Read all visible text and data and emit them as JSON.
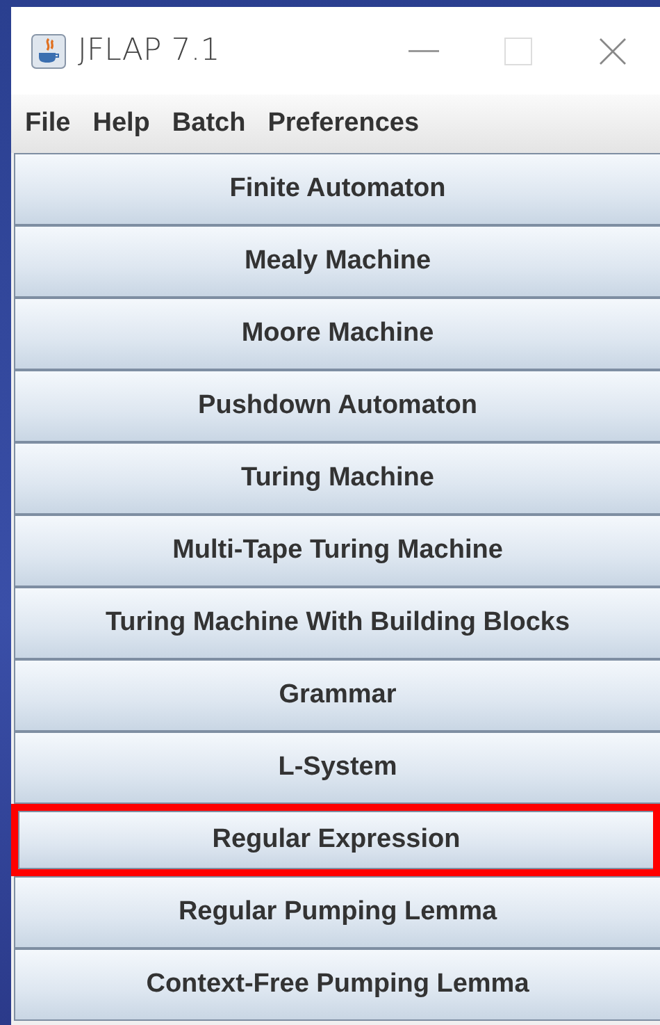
{
  "window": {
    "title": "JFLAP 7.1"
  },
  "menu": [
    "File",
    "Help",
    "Batch",
    "Preferences"
  ],
  "buttons": [
    {
      "label": "Finite Automaton",
      "highlighted": false
    },
    {
      "label": "Mealy Machine",
      "highlighted": false
    },
    {
      "label": "Moore Machine",
      "highlighted": false
    },
    {
      "label": "Pushdown Automaton",
      "highlighted": false
    },
    {
      "label": "Turing Machine",
      "highlighted": false
    },
    {
      "label": "Multi-Tape Turing Machine",
      "highlighted": false
    },
    {
      "label": "Turing Machine With Building Blocks",
      "highlighted": false
    },
    {
      "label": "Grammar",
      "highlighted": false
    },
    {
      "label": "L-System",
      "highlighted": false
    },
    {
      "label": "Regular Expression",
      "highlighted": true
    },
    {
      "label": "Regular Pumping Lemma",
      "highlighted": false
    },
    {
      "label": "Context-Free Pumping Lemma",
      "highlighted": false
    }
  ]
}
